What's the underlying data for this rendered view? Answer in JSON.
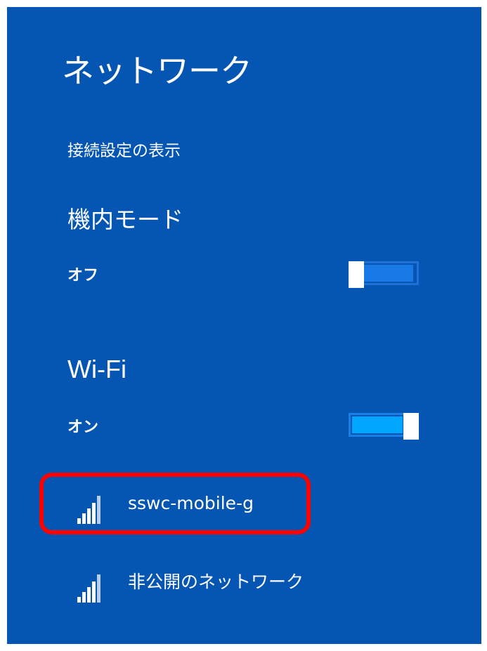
{
  "panel": {
    "title": "ネットワーク",
    "settings_link": "接続設定の表示",
    "background_color": "#0555b3"
  },
  "airplane_mode": {
    "title": "機内モード",
    "state_label": "オフ",
    "enabled": false
  },
  "wifi": {
    "title": "Wi-Fi",
    "state_label": "オン",
    "enabled": true
  },
  "networks": [
    {
      "name": "sswc-mobile-g",
      "icon": "wifi-signal-icon",
      "highlighted": true
    },
    {
      "name": "非公開のネットワーク",
      "icon": "wifi-signal-icon",
      "highlighted": false
    }
  ],
  "colors": {
    "toggle_on": "#00a6ff",
    "highlight": "#ff0000"
  }
}
